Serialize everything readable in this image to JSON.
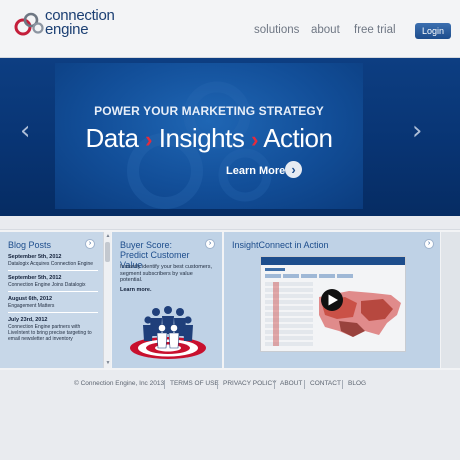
{
  "header": {
    "logo_line1": "connection",
    "logo_line2": "engine",
    "nav": [
      {
        "label": "solutions"
      },
      {
        "label": "about"
      },
      {
        "label": "free trial"
      }
    ],
    "login_label": "Login"
  },
  "hero": {
    "kicker": "POWER YOUR MARKETING STRATEGY",
    "headline_parts": [
      "Data",
      "Insights",
      "Action"
    ],
    "separator": "›",
    "cta_label": "Learn More",
    "prev_arrow": "‹",
    "next_arrow": "›",
    "colors": {
      "background": "#083473",
      "separator": "#e52b3d"
    }
  },
  "panels": {
    "blog": {
      "title": "Blog Posts",
      "items": [
        {
          "date": "September 5th, 2012",
          "text": "Datalogix Acquires Connection Engine"
        },
        {
          "date": "September 5th, 2012",
          "text": "Connection Engine Joins Datalogix"
        },
        {
          "date": "August 6th, 2012",
          "text": "Engagement Matters"
        },
        {
          "date": "July 23rd, 2012",
          "text": "Connection Engine partners with LiveIntent to bring precise targeting to email newsletter ad inventory"
        }
      ]
    },
    "buyer": {
      "title": "Buyer Score: Predict Customer Value",
      "description": "Instantly identify your best customers, segment subscribers by value potential.",
      "learn_more": "Learn more."
    },
    "insight": {
      "title": "InsightConnect in Action"
    }
  },
  "footer": {
    "copyright": "© Connection Engine, Inc 2013",
    "links": [
      "TERMS OF USE",
      "PRIVACY POLICY",
      "ABOUT",
      "CONTACT",
      "BLOG"
    ]
  },
  "icons": {
    "go": "›",
    "scroll_up": "▲",
    "scroll_down": "▼",
    "play": "play-icon"
  }
}
